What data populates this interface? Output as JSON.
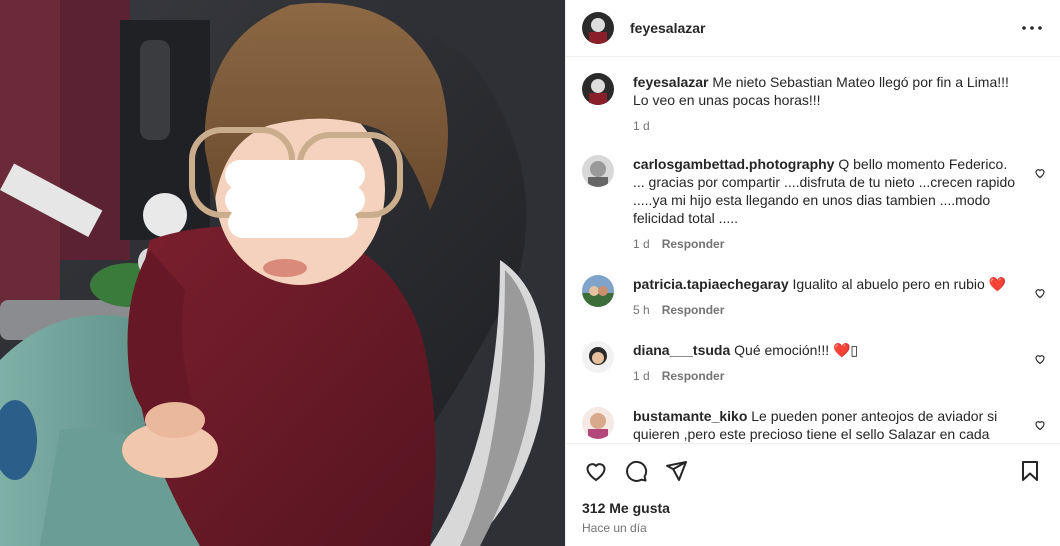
{
  "post": {
    "author": "feyesalazar",
    "caption": "Me nieto Sebastian Mateo llegó por fin a Lima!!! Lo veo en unas pocas horas!!!",
    "caption_time": "1 d"
  },
  "comments": [
    {
      "username": "carlosgambettad.photography",
      "text": "Q bello momento Federico. ... gracias por compartir ....disfruta de tu nieto ...crecen rapido .....ya mi hijo esta llegando en unos dias tambien ....modo felicidad total .....",
      "time": "1 d",
      "reply_label": "Responder"
    },
    {
      "username": "patricia.tapiaechegaray",
      "text": "Igualito al abuelo pero en rubio ❤️",
      "time": "5 h",
      "reply_label": "Responder"
    },
    {
      "username": "diana___tsuda",
      "text": "Qué emoción!!! ❤️▯",
      "time": "1 d",
      "reply_label": "Responder"
    },
    {
      "username": "bustamante_kiko",
      "text": "Le pueden poner anteojos de aviador si quieren ,pero este precioso tiene el sello Salazar en cada"
    }
  ],
  "footer": {
    "likes": "312 Me gusta",
    "time_ago": "Hace un día"
  },
  "icons": {
    "more": "more-options-icon",
    "like": "heart-icon",
    "comment": "comment-bubble-icon",
    "share": "paper-plane-icon",
    "save": "bookmark-icon",
    "comment_like": "small-heart-icon"
  },
  "colors": {
    "text_primary": "#262626",
    "text_secondary": "#737373",
    "divider": "#efefef",
    "heart_red": "#ed1b35"
  }
}
